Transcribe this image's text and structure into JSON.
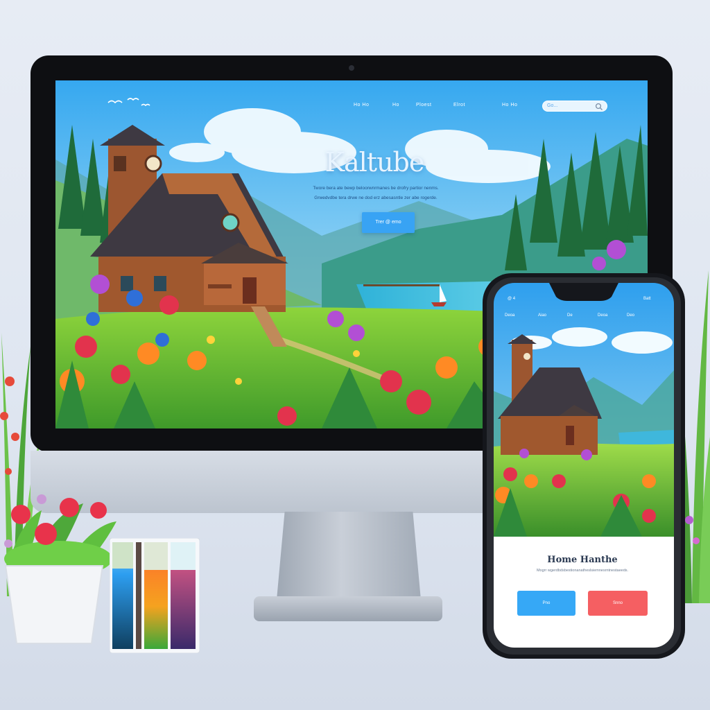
{
  "desktop": {
    "nav": [
      {
        "label": "Ho Ho",
        "icon": "nav-link-1"
      },
      {
        "label": "Ho",
        "icon": "nav-link-2"
      },
      {
        "label": "Ploest",
        "icon": "nav-link-3"
      },
      {
        "label": "Elrot",
        "icon": "nav-link-4"
      },
      {
        "label": "Ho Ho",
        "icon": "nav-link-5"
      }
    ],
    "search_label": "Go...",
    "hero_title": "Kaltube",
    "hero_sub_line1": "Twore bera ate bewp beloorwnrmanes be drofry partior nenms.",
    "hero_sub_line2": "Grwedvdbe tera drwe ne dod erz abesasntle zer abe rogerde.",
    "cta_label": "Trer @ emo"
  },
  "phone": {
    "status_left": "@ 4",
    "status_right": "Batt",
    "nav": [
      "Deoa",
      "Aiao",
      "De",
      "Deoa",
      "Deo"
    ],
    "card_title": "Home Hanthe",
    "card_text": "Mogrr wgerdbdsbestionanatheslsiemnesrntnestaeeds.",
    "btn_primary": "Pno",
    "btn_secondary": "Snno"
  },
  "colors": {
    "sky": "#4fb6f0",
    "cta": "#38a3f4",
    "phone_primary": "#36a8f6",
    "phone_secondary": "#f55f62",
    "cabin": "#a0582e",
    "roof": "#3e3942"
  },
  "icons": [
    "birds-icon",
    "search-icon",
    "webcam-icon",
    "sailboat-icon",
    "clock-icon"
  ]
}
